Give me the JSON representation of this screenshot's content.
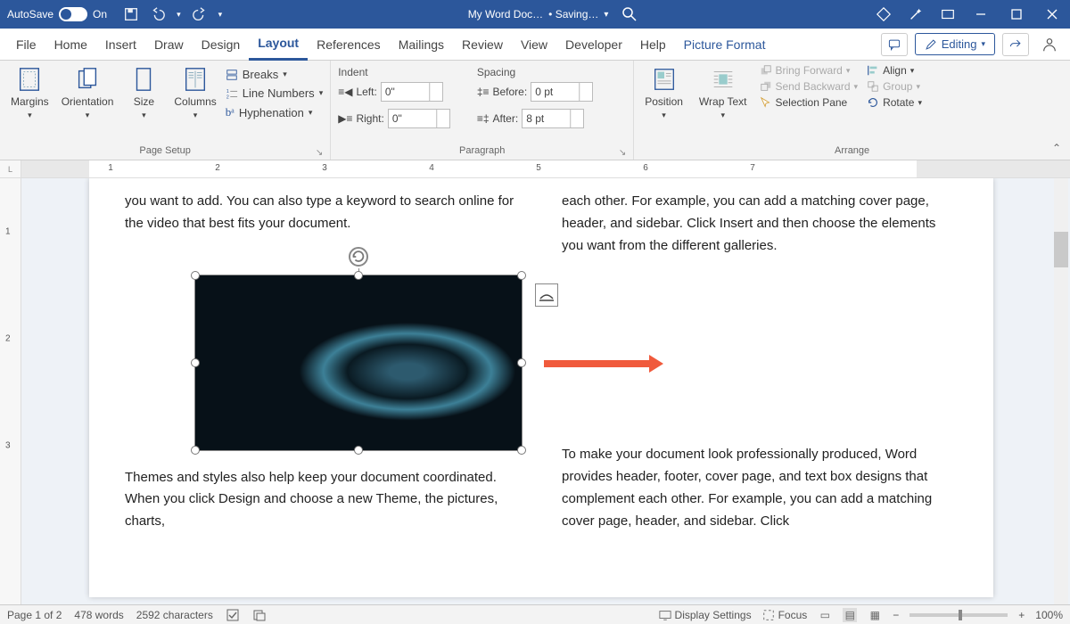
{
  "titlebar": {
    "autosave_label": "AutoSave",
    "autosave_on": "On",
    "doc_name": "My Word Doc…",
    "saving": "• Saving…"
  },
  "tabs": [
    "File",
    "Home",
    "Insert",
    "Draw",
    "Design",
    "Layout",
    "References",
    "Mailings",
    "Review",
    "View",
    "Developer",
    "Help"
  ],
  "contextual_tab": "Picture Format",
  "editing_label": "Editing",
  "ribbon": {
    "page_setup": {
      "label": "Page Setup",
      "margins": "Margins",
      "orientation": "Orientation",
      "size": "Size",
      "columns": "Columns",
      "breaks": "Breaks",
      "line_numbers": "Line Numbers",
      "hyphenation": "Hyphenation"
    },
    "paragraph": {
      "label": "Paragraph",
      "indent": "Indent",
      "spacing": "Spacing",
      "left": "Left:",
      "right": "Right:",
      "before": "Before:",
      "after": "After:",
      "left_val": "0\"",
      "right_val": "0\"",
      "before_val": "0 pt",
      "after_val": "8 pt"
    },
    "arrange": {
      "label": "Arrange",
      "position": "Position",
      "wrap": "Wrap Text",
      "bring_forward": "Bring Forward",
      "send_backward": "Send Backward",
      "selection_pane": "Selection Pane",
      "align": "Align",
      "group": "Group",
      "rotate": "Rotate"
    }
  },
  "ruler_marks": [
    "1",
    "2",
    "3",
    "4",
    "5",
    "6",
    "7"
  ],
  "vruler_marks": [
    "1",
    "2",
    "3"
  ],
  "doc": {
    "para1_a": "you want to add. You can also type a keyword to search online for the video that best fits your document.",
    "para1_b": "each other. For example, you can add a matching cover page, header, and sidebar. Click Insert and then choose the elements you want from the different galleries.",
    "para2_a": "Themes and styles also help keep your document coordinated. When you click Design and choose a new Theme, the pictures, charts,",
    "para2_b": "To make your document look professionally produced, Word provides header, footer, cover page, and text box designs that complement each other. For example, you can add a matching cover page, header, and sidebar. Click"
  },
  "status": {
    "page": "Page 1 of 2",
    "words": "478 words",
    "chars": "2592 characters",
    "display_settings": "Display Settings",
    "focus": "Focus",
    "zoom": "100%"
  }
}
